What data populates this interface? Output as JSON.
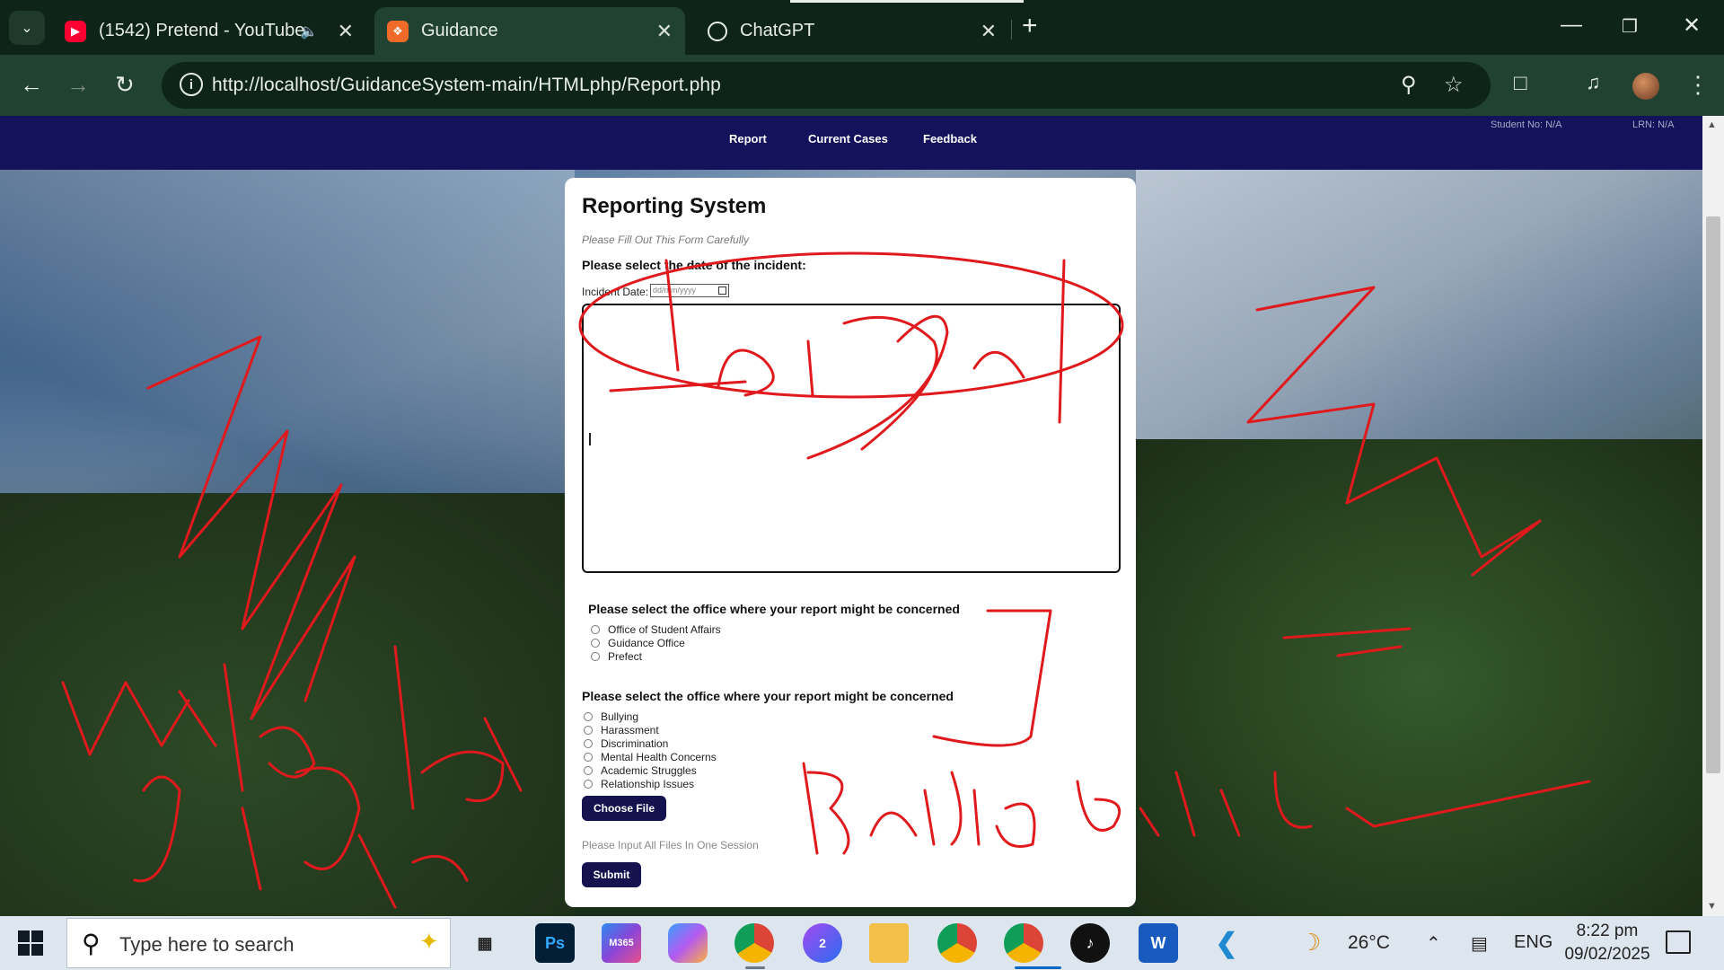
{
  "browser": {
    "tabs": [
      {
        "title": "(1542) Pretend - YouTube",
        "favicon": "youtube-icon",
        "audio": true
      },
      {
        "title": "Guidance",
        "favicon": "xampp-icon",
        "active": true
      },
      {
        "title": "ChatGPT",
        "favicon": "chatgpt-icon"
      }
    ],
    "url": "http://localhost/GuidanceSystem-main/HTMLphp/Report.php"
  },
  "site": {
    "nav": [
      "Report",
      "Current Cases",
      "Feedback"
    ],
    "student_no": "Student No: N/A",
    "lrn": "LRN: N/A"
  },
  "form": {
    "title": "Reporting System",
    "subtitle": "Please Fill Out This Form Carefully",
    "date_question": "Please select the date of the incident:",
    "date_label": "Incident Date:",
    "date_placeholder": "dd/mm/yyyy",
    "office_question": "Please select the office where your report might be concerned",
    "offices": [
      "Office of Student Affairs",
      "Guidance Office",
      "Prefect"
    ],
    "category_question": "Please select the office where your report might be concerned",
    "categories": [
      "Bullying",
      "Harassment",
      "Discrimination",
      "Mental Health Concerns",
      "Academic Struggles",
      "Relationship Issues"
    ],
    "choose_file_label": "Choose File",
    "upload_hint": "Please Input All Files In One Session",
    "submit_label": "Submit"
  },
  "taskbar": {
    "search_placeholder": "Type here to search",
    "temperature": "26°C",
    "language": "ENG",
    "time": "8:22 pm",
    "date": "09/02/2025",
    "apps": [
      "task-view",
      "photoshop",
      "m365",
      "copilot",
      "chrome",
      "messenger",
      "file-explorer",
      "chrome-profile",
      "chrome-active",
      "tiktok",
      "word",
      "vscode"
    ]
  },
  "colors": {
    "browser_frame": "#0e2418",
    "browser_toolbar": "#214231",
    "site_nav": "#14125a",
    "button": "#14124f",
    "annotation": "#e0191c"
  }
}
